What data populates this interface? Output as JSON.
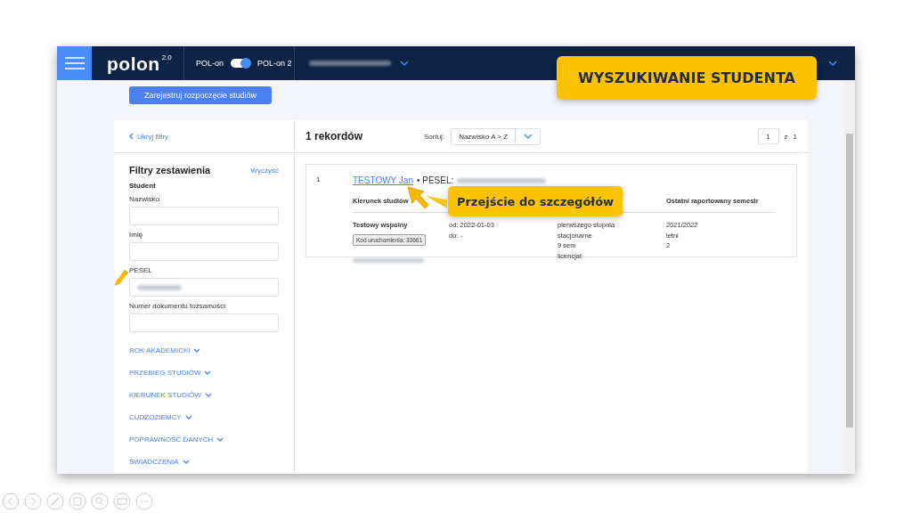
{
  "slide_title": "WYSZUKIWANIE STUDENTA",
  "header": {
    "logo": "polon",
    "logo_version": "2.0",
    "toggle": {
      "label_left": "POL-on",
      "label_right": "POL-on 2",
      "on": true
    }
  },
  "register_button": "Zarejestruj rozpoczęcie studiów",
  "filters": {
    "hide_link": "Ukryj filtry",
    "title": "Filtry zestawienia",
    "clear_link": "Wyczyść",
    "section": "Student",
    "fields": [
      {
        "label": "Nazwisko"
      },
      {
        "label": "Imię"
      },
      {
        "label": "PESEL",
        "kind": "redacted"
      },
      {
        "label": "Numer dokumentu tożsamości"
      }
    ],
    "groups": [
      {
        "label": "ROK AKADEMICKI",
        "expanded": false
      },
      {
        "label": "PRZEBIEG STUDIÓW",
        "expanded": false
      },
      {
        "label": "KIERUNEK STUDIÓW",
        "expanded": false
      },
      {
        "label": "CUDZOZIEMCY",
        "expanded": false
      },
      {
        "label": "POPRAWNOŚĆ DANYCH",
        "expanded": false
      },
      {
        "label": "ŚWIADCZENIA",
        "expanded": false
      }
    ]
  },
  "results": {
    "count": "1 rekordów",
    "sort_label": "Sortuj:",
    "sort_value": "Nazwisko A > Z",
    "page": "1",
    "page_of": "z",
    "page_total": "1",
    "records": [
      {
        "index": "1",
        "name": "TESTOWY Jan",
        "id_label": "• PESEL:",
        "columns": [
          {
            "header": "Kierunek studiów",
            "lines": [
              "Testowy wspolny"
            ],
            "badge": "Kod uruchomienia: 33661"
          },
          {
            "lines": [
              "od: 2022-01-03",
              "do: -"
            ]
          },
          {
            "lines": [
              "pierwszego stopnia",
              "stacjonarne",
              "9 sem",
              "licencjat"
            ]
          },
          {
            "header": "Ostatni raportowany semestr",
            "lines": [
              "2021/2022",
              "letni",
              "2"
            ]
          }
        ]
      }
    ]
  },
  "callout": "Przejście do szczegółów"
}
